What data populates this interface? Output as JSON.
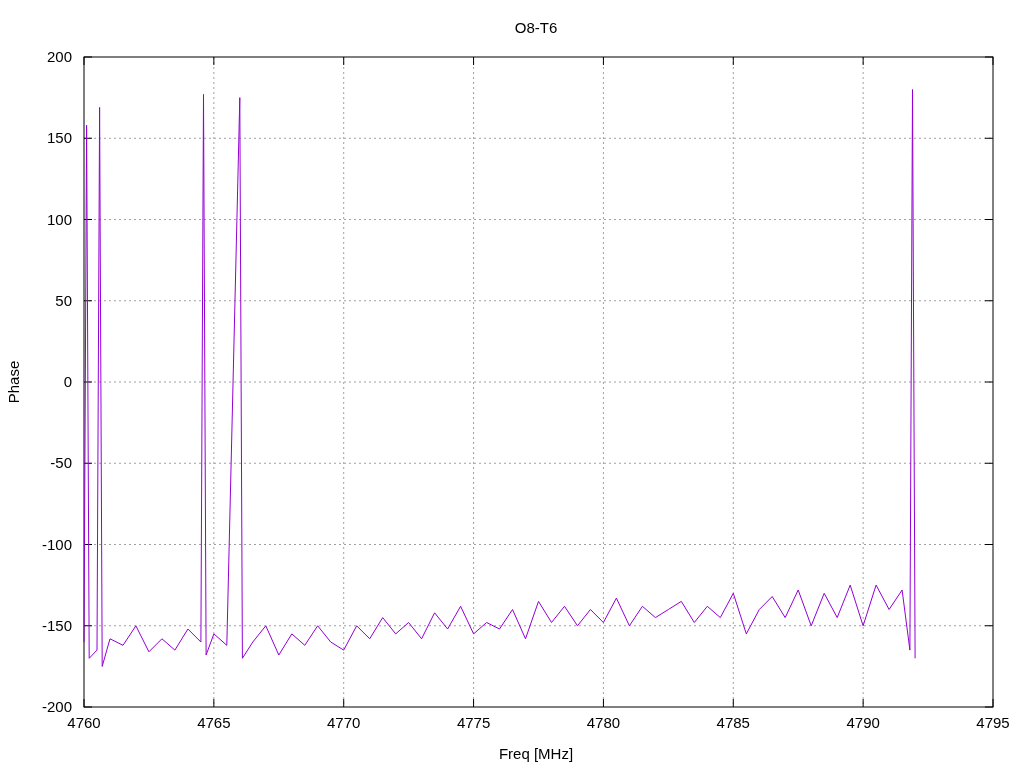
{
  "chart_data": {
    "type": "line",
    "title": "O8-T6",
    "xlabel": "Freq [MHz]",
    "ylabel": "Phase",
    "x": [
      4760,
      4760.1,
      4760.2,
      4760.5,
      4760.6,
      4760.7,
      4761,
      4761.5,
      4762,
      4762.5,
      4763,
      4763.5,
      4764,
      4764.5,
      4764.6,
      4764.7,
      4765,
      4765.5,
      4766,
      4766.1,
      4766.5,
      4767,
      4767.5,
      4768,
      4768.5,
      4769,
      4769.5,
      4770,
      4770.5,
      4771,
      4771.5,
      4772,
      4772.5,
      4773,
      4773.5,
      4774,
      4774.5,
      4775,
      4775.5,
      4776,
      4776.5,
      4777,
      4777.5,
      4778,
      4778.5,
      4779,
      4779.5,
      4780,
      4780.5,
      4781,
      4781.5,
      4782,
      4782.5,
      4783,
      4783.5,
      4784,
      4784.5,
      4785,
      4785.5,
      4786,
      4786.5,
      4787,
      4787.5,
      4788,
      4788.5,
      4789,
      4789.5,
      4790,
      4790.5,
      4791,
      4791.5,
      4791.8,
      4791.9,
      4792
    ],
    "series": [
      {
        "color": "#9400d3",
        "values": [
          -160,
          158,
          -170,
          -165,
          169,
          -175,
          -158,
          -162,
          -150,
          -166,
          -158,
          -165,
          -152,
          -160,
          177,
          -168,
          -155,
          -162,
          175,
          -170,
          -160,
          -150,
          -168,
          -155,
          -162,
          -150,
          -160,
          -165,
          -150,
          -158,
          -145,
          -155,
          -148,
          -158,
          -142,
          -152,
          -138,
          -155,
          -148,
          -152,
          -140,
          -158,
          -135,
          -148,
          -138,
          -150,
          -140,
          -148,
          -133,
          -150,
          -138,
          -145,
          -140,
          -135,
          -148,
          -138,
          -145,
          -130,
          -155,
          -140,
          -132,
          -145,
          -128,
          -150,
          -130,
          -145,
          -125,
          -150,
          -125,
          -140,
          -128,
          -165,
          180,
          -170
        ]
      }
    ],
    "xlim": [
      4760,
      4795
    ],
    "ylim": [
      -200,
      200
    ],
    "xticks": [
      4760,
      4765,
      4770,
      4775,
      4780,
      4785,
      4790,
      4795
    ],
    "yticks": [
      -200,
      -150,
      -100,
      -50,
      0,
      50,
      100,
      150,
      200
    ],
    "grid": true
  }
}
